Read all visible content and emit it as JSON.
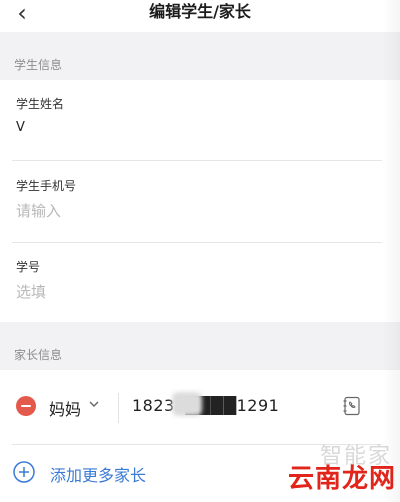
{
  "header": {
    "title": "编辑学生/家长",
    "back_icon": "chevron-left-icon"
  },
  "student_section": {
    "label": "学生信息",
    "name": {
      "label": "学生姓名",
      "value": "V"
    },
    "phone": {
      "label": "学生手机号",
      "placeholder": "请输入"
    },
    "student_no": {
      "label": "学号",
      "placeholder": "选填"
    }
  },
  "parent_section": {
    "label": "家长信息",
    "parents": [
      {
        "relation": "妈妈",
        "phone": "18231████1291"
      }
    ],
    "add_label": "添加更多家长"
  },
  "watermark": {
    "top": "智能家",
    "main": "云南龙网"
  },
  "colors": {
    "remove": "#e35a4d",
    "accent": "#3a7bd5",
    "watermark": "#e1251b"
  }
}
